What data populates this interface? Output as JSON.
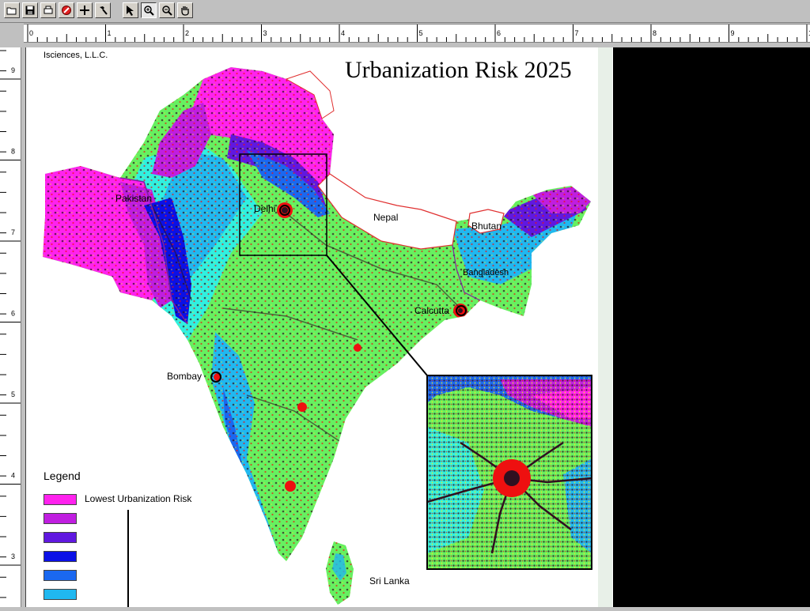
{
  "toolbar": {
    "buttons": [
      {
        "name": "open-icon",
        "glyph": "📂"
      },
      {
        "name": "save-icon",
        "glyph": "💾"
      },
      {
        "name": "print-icon",
        "glyph": "🖨"
      },
      {
        "name": "stop-icon",
        "glyph": "⊘"
      },
      {
        "name": "crosshair-icon",
        "glyph": "+"
      },
      {
        "name": "hammer-icon",
        "glyph": "🔨"
      },
      {
        "name": "pointer-icon",
        "glyph": "↖"
      },
      {
        "name": "zoom-in-icon",
        "glyph": "⊕"
      },
      {
        "name": "zoom-out-icon",
        "glyph": "🔍"
      },
      {
        "name": "hand-icon",
        "glyph": "✋"
      }
    ]
  },
  "ruler": {
    "horizontal_labels": [
      "0",
      "1",
      "2",
      "3",
      "4",
      "5",
      "6",
      "7",
      "8",
      "9",
      "1"
    ],
    "vertical_labels": [
      "9",
      "8",
      "7",
      "6",
      "5",
      "4",
      "3"
    ]
  },
  "map": {
    "credit": "Isciences, L.L.C.",
    "title": "Urbanization Risk 2025",
    "labels": {
      "pakistan": "Pakistan",
      "delhi": "Delhi",
      "nepal": "Nepal",
      "bhutan": "Bhutan",
      "bangladesh": "Bangladesh",
      "calcutta": "Calcutta",
      "bombay": "Bombay",
      "sri_lanka": "Sri Lanka"
    },
    "colors": {
      "magenta": "#ff22ee",
      "violet": "#c01ee0",
      "indigo": "#6018e0",
      "blue": "#0b10e6",
      "mid_blue": "#1a68f0",
      "cyan": "#20b8f0",
      "aqua": "#30f0e0",
      "green": "#66f060",
      "yellow": "#f0f020",
      "red": "#ee1010",
      "dark": "#301020"
    }
  },
  "legend": {
    "title": "Legend",
    "items": [
      {
        "label": "Lowest Urbanization Risk",
        "color": "#ff22ee"
      },
      {
        "label": "",
        "color": "#c01ee0"
      },
      {
        "label": "",
        "color": "#6018e0"
      },
      {
        "label": "",
        "color": "#0b10e6"
      },
      {
        "label": "",
        "color": "#1a68f0"
      },
      {
        "label": "",
        "color": "#20b8f0"
      }
    ]
  }
}
